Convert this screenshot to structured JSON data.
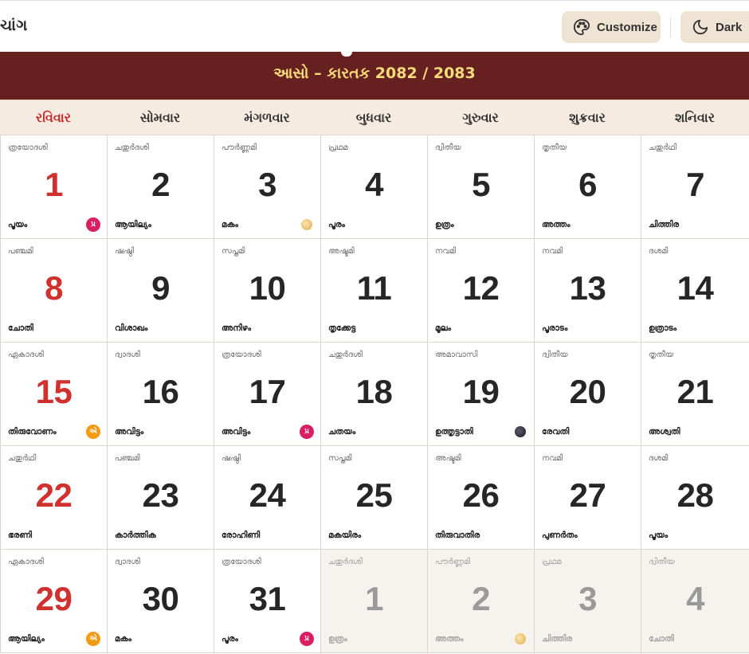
{
  "app": {
    "title": "ચાંગ"
  },
  "toolbar": {
    "customize_label": "Customize",
    "dark_label": "Dark"
  },
  "month": {
    "title": "આસો – કારતક 2082 / 2083"
  },
  "weekdays": [
    "રવિવાર",
    "સોમવાર",
    "મંગળવાર",
    "બુધવાર",
    "ગુરુવાર",
    "શુક્રવાર",
    "શનિવાર"
  ],
  "colors": {
    "banner": "#672020",
    "banner_text": "#f7dc7a",
    "sunday": "#d0302e",
    "weekday_bar": "#f5ebe0",
    "button_bg": "#efe3d4",
    "pradosh": "#d81f63",
    "ekadashi": "#f39a12"
  },
  "days": [
    {
      "date": "1",
      "tithi": "ത്രയോദശി",
      "nakshatra": "പൂയം",
      "badge": "pradosh",
      "badge_text": "પ્ર"
    },
    {
      "date": "2",
      "tithi": "ചതുർദശി",
      "nakshatra": "ആയില്യം"
    },
    {
      "date": "3",
      "tithi": "പൗർണ്ണമി",
      "nakshatra": "മകം",
      "badge": "fullmoon",
      "badge_text": ""
    },
    {
      "date": "4",
      "tithi": "പ്രഥമ",
      "nakshatra": "പൂരം"
    },
    {
      "date": "5",
      "tithi": "ദ്വിതീയ",
      "nakshatra": "ഉത്രം"
    },
    {
      "date": "6",
      "tithi": "തൃതീയ",
      "nakshatra": "അത്തം"
    },
    {
      "date": "7",
      "tithi": "ചതുർഥി",
      "nakshatra": "ചിത്തിര"
    },
    {
      "date": "8",
      "tithi": "പഞ്ചമി",
      "nakshatra": "ചോതി"
    },
    {
      "date": "9",
      "tithi": "ഷഷ്ഠി",
      "nakshatra": "വിശാഖം"
    },
    {
      "date": "10",
      "tithi": "സപ്തമി",
      "nakshatra": "അനിഴം"
    },
    {
      "date": "11",
      "tithi": "അഷ്ടമി",
      "nakshatra": "തൃക്കേട്ട"
    },
    {
      "date": "12",
      "tithi": "നവമി",
      "nakshatra": "മൂലം"
    },
    {
      "date": "13",
      "tithi": "നവമി",
      "nakshatra": "പൂരാടം"
    },
    {
      "date": "14",
      "tithi": "ദശമി",
      "nakshatra": "ഉത്രാടം"
    },
    {
      "date": "15",
      "tithi": "ഏകാദശി",
      "nakshatra": "തിരുവോണം",
      "badge": "ekadashi",
      "badge_text": "એ"
    },
    {
      "date": "16",
      "tithi": "ദ്വാദശി",
      "nakshatra": "അവിട്ടം"
    },
    {
      "date": "17",
      "tithi": "ത്രയോദശി",
      "nakshatra": "അവിട്ടം",
      "badge": "pradosh",
      "badge_text": "પ્ર"
    },
    {
      "date": "18",
      "tithi": "ചതുർദശി",
      "nakshatra": "ചതയം"
    },
    {
      "date": "19",
      "tithi": "അമാവാസി",
      "nakshatra": "ഉത്തൃട്ടാതി",
      "badge": "newmoon",
      "badge_text": ""
    },
    {
      "date": "20",
      "tithi": "ദ്വിതീയ",
      "nakshatra": "രേവതി"
    },
    {
      "date": "21",
      "tithi": "തൃതീയ",
      "nakshatra": "അശ്വതി"
    },
    {
      "date": "22",
      "tithi": "ചതുർഥി",
      "nakshatra": "ഭരണി"
    },
    {
      "date": "23",
      "tithi": "പഞ്ചമി",
      "nakshatra": "കാർത്തിക"
    },
    {
      "date": "24",
      "tithi": "ഷഷ്ഠി",
      "nakshatra": "രോഹിണി"
    },
    {
      "date": "25",
      "tithi": "സപ്തമി",
      "nakshatra": "മകയിരം"
    },
    {
      "date": "26",
      "tithi": "അഷ്ടമി",
      "nakshatra": "തിരുവാതിര"
    },
    {
      "date": "27",
      "tithi": "നവമി",
      "nakshatra": "പുണർതം"
    },
    {
      "date": "28",
      "tithi": "ദശമി",
      "nakshatra": "പൂയം"
    },
    {
      "date": "29",
      "tithi": "ഏകാദശി",
      "nakshatra": "ആയില്യം",
      "badge": "ekadashi",
      "badge_text": "એ"
    },
    {
      "date": "30",
      "tithi": "ദ്വാദശി",
      "nakshatra": "മകം"
    },
    {
      "date": "31",
      "tithi": "ത്രയോദശി",
      "nakshatra": "പൂരം",
      "badge": "pradosh",
      "badge_text": "પ્ર"
    },
    {
      "date": "1",
      "tithi": "ചതുർദശി",
      "nakshatra": "ഉത്രം",
      "other": true
    },
    {
      "date": "2",
      "tithi": "പൗർണ്ണമി",
      "nakshatra": "അത്തം",
      "badge": "fullmoon",
      "badge_text": "",
      "other": true
    },
    {
      "date": "3",
      "tithi": "പ്രഥമ",
      "nakshatra": "ചിത്തിര",
      "other": true
    },
    {
      "date": "4",
      "tithi": "ദ്വിതീയ",
      "nakshatra": "ചോതി",
      "other": true
    }
  ]
}
